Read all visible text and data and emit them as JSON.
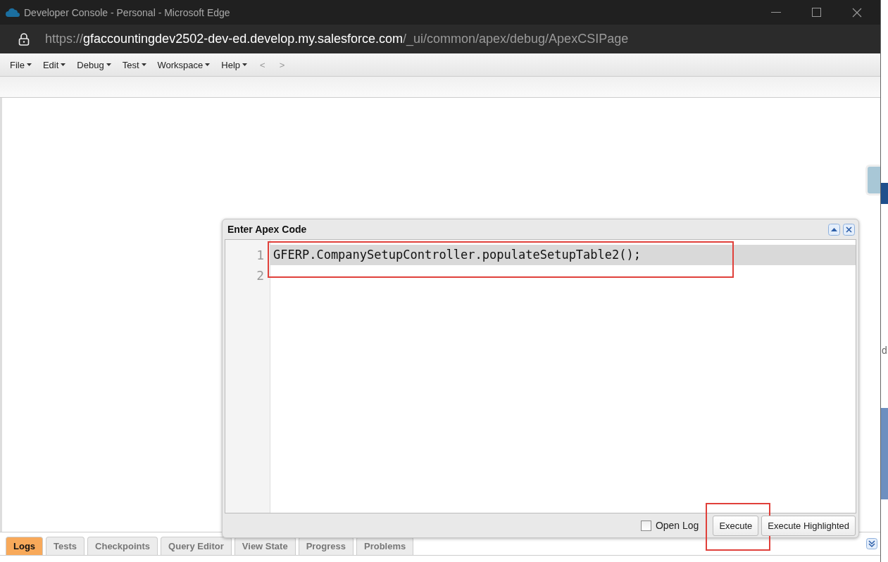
{
  "window": {
    "title": "Developer Console - Personal - Microsoft Edge"
  },
  "address_bar": {
    "scheme": "https://",
    "host": "gfaccountingdev2502-dev-ed.develop.my.salesforce.com",
    "path": "/_ui/common/apex/debug/ApexCSIPage"
  },
  "menu": [
    {
      "label": "File"
    },
    {
      "label": "Edit"
    },
    {
      "label": "Debug"
    },
    {
      "label": "Test"
    },
    {
      "label": "Workspace"
    },
    {
      "label": "Help"
    }
  ],
  "nav": [
    {
      "label": "<",
      "disabled": true
    },
    {
      "label": ">",
      "disabled": true
    }
  ],
  "dialog": {
    "title": "Enter Apex Code",
    "lines": [
      {
        "number": "1",
        "text": "GFERP.CompanySetupController.populateSetupTable2();",
        "highlighted": true
      },
      {
        "number": "2",
        "highlighted": false
      }
    ],
    "open_log": {
      "label": "Open Log",
      "checked": false
    },
    "buttons": [
      "Execute",
      "Execute Highlighted"
    ]
  },
  "tabs": [
    {
      "label": "Logs",
      "selected": true
    },
    {
      "label": "Tests",
      "selected": false
    },
    {
      "label": "Checkpoints",
      "selected": false
    },
    {
      "label": "Query Editor",
      "selected": false
    },
    {
      "label": "View State",
      "selected": false
    },
    {
      "label": "Progress",
      "selected": false
    },
    {
      "label": "Problems",
      "selected": false
    }
  ],
  "background_page": {
    "text": "d"
  }
}
